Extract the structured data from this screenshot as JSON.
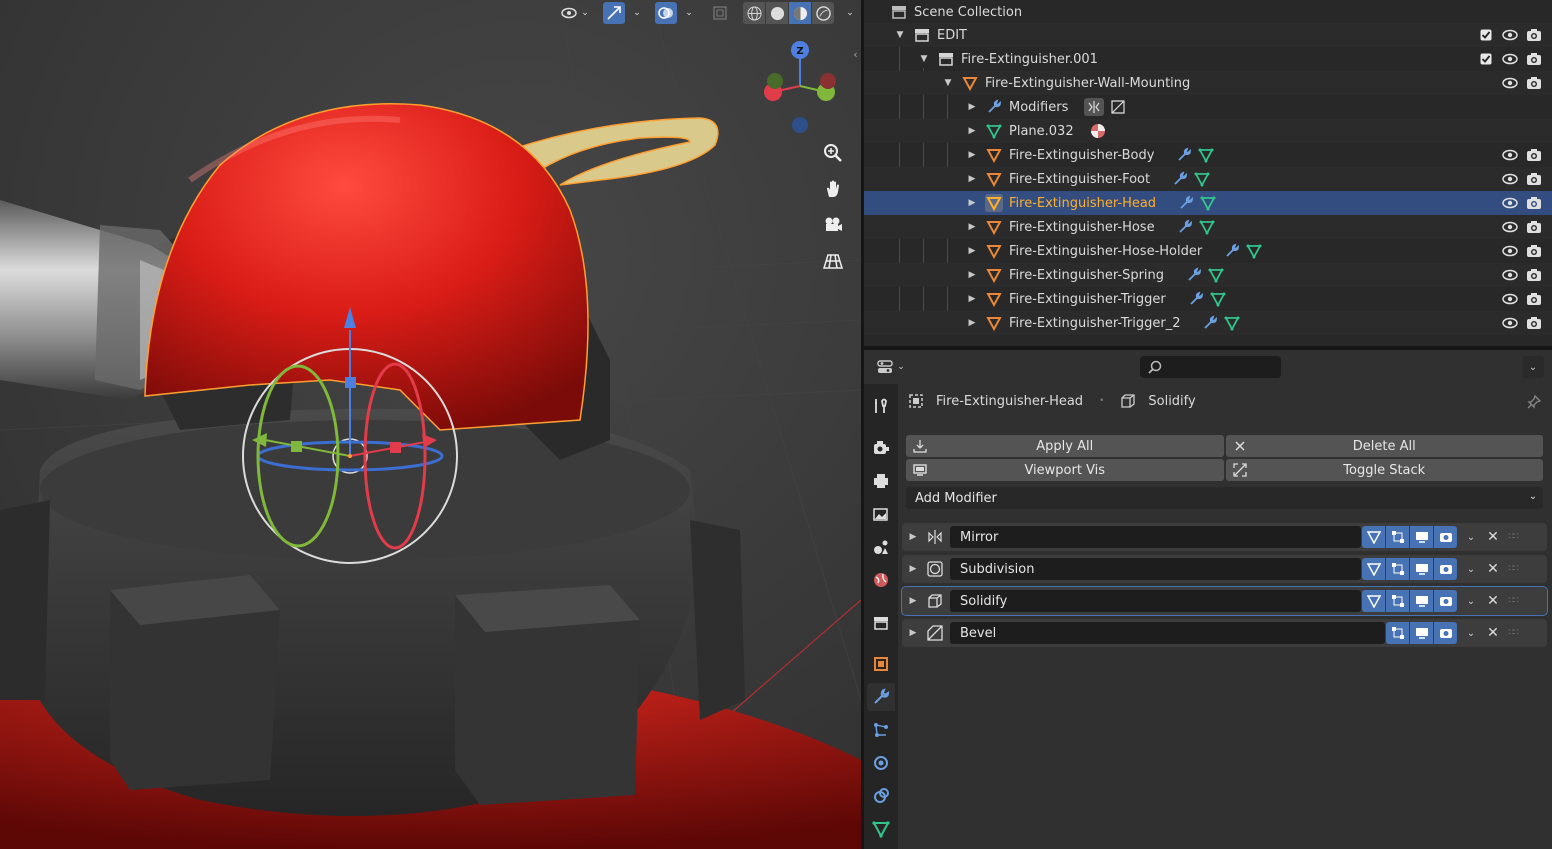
{
  "outliner": {
    "rows": [
      {
        "label": "Scene Collection"
      },
      {
        "label": "EDIT"
      },
      {
        "label": "Fire-Extinguisher.001"
      },
      {
        "label": "Fire-Extinguisher-Wall-Mounting"
      },
      {
        "label": "Modifiers"
      },
      {
        "label": "Plane.032"
      },
      {
        "label": "Fire-Extinguisher-Body"
      },
      {
        "label": "Fire-Extinguisher-Foot"
      },
      {
        "label": "Fire-Extinguisher-Head",
        "selected": true
      },
      {
        "label": "Fire-Extinguisher-Hose"
      },
      {
        "label": "Fire-Extinguisher-Hose-Holder"
      },
      {
        "label": "Fire-Extinguisher-Spring"
      },
      {
        "label": "Fire-Extinguisher-Trigger"
      },
      {
        "label": "Fire-Extinguisher-Trigger_2"
      }
    ]
  },
  "viewport": {
    "gizmo_axis_label": "Z"
  },
  "properties": {
    "search_placeholder": "",
    "breadcrumb": {
      "object": "Fire-Extinguisher-Head",
      "modifier": "Solidify"
    },
    "buttons": {
      "apply_all": "Apply All",
      "delete_all": "Delete All",
      "viewport_vis": "Viewport Vis",
      "toggle_stack": "Toggle Stack"
    },
    "add_modifier": "Add Modifier",
    "modifiers": [
      {
        "name": "Mirror",
        "icon": "mirror-icon"
      },
      {
        "name": "Subdivision",
        "icon": "subdivision-icon"
      },
      {
        "name": "Solidify",
        "icon": "solidify-icon",
        "active": true
      },
      {
        "name": "Bevel",
        "icon": "bevel-icon"
      }
    ]
  },
  "colors": {
    "accent": "#4772b3",
    "selected_text": "#ffaf29",
    "mesh_object": "#e8873a",
    "modifier_wrench": "#6b9fe0",
    "mesh_data": "#32c48a"
  }
}
